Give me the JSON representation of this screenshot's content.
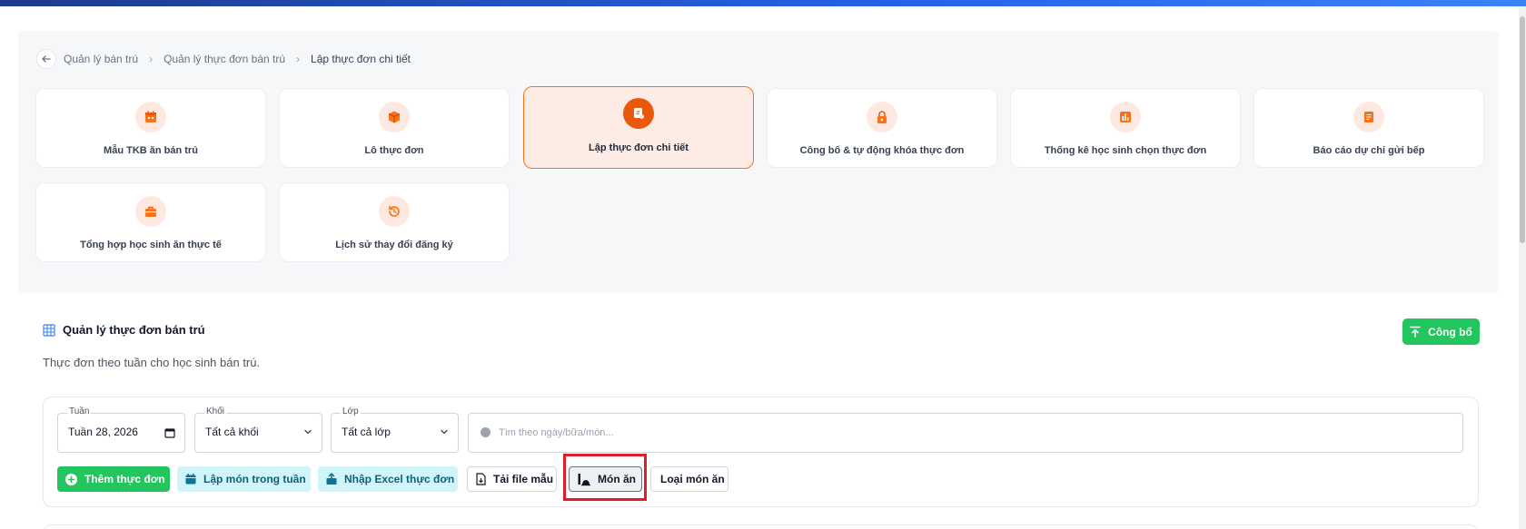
{
  "breadcrumb": {
    "items": [
      "Quản lý bán trú",
      "Quản lý thực đơn bán trú"
    ],
    "current": "Lập thực đơn chi tiết"
  },
  "tiles": [
    {
      "label": "Mẫu TKB ăn bán trú",
      "icon": "calendar-icon",
      "active": false
    },
    {
      "label": "Lô thực đơn",
      "icon": "box-icon",
      "active": false
    },
    {
      "label": "Lập thực đơn chi tiết",
      "icon": "recipe-icon",
      "active": true
    },
    {
      "label": "Công bố & tự động khóa thực đơn",
      "icon": "lock-icon",
      "active": false
    },
    {
      "label": "Thống kê học sinh chọn thực đơn",
      "icon": "bar-chart-icon",
      "active": false
    },
    {
      "label": "Báo cáo dự chi gửi bếp",
      "icon": "report-icon",
      "active": false
    },
    {
      "label": "Tổng hợp học sinh ăn thực tế",
      "icon": "briefcase-icon",
      "active": false
    },
    {
      "label": "Lịch sử thay đổi đăng ký",
      "icon": "history-icon",
      "active": false
    }
  ],
  "section": {
    "title": "Quản lý thực đơn bán trú",
    "subtitle": "Thực đơn theo tuần cho học sinh bán trú.",
    "publish_label": "Công bố"
  },
  "filters": {
    "week": {
      "label": "Tuần",
      "value": "Tuần 28, 2026"
    },
    "grade": {
      "label": "Khối",
      "value": "Tất cả khối"
    },
    "class": {
      "label": "Lớp",
      "value": "Tất cả lớp"
    },
    "search_placeholder": "Tìm theo ngày/bữa/món..."
  },
  "actions": {
    "add_menu": "Thêm thực đơn",
    "weekly_dishes": "Lập món trong tuần",
    "import_excel": "Nhập Excel thực đơn",
    "download_template": "Tải file mẫu",
    "dishes": "Món ăn",
    "dish_types": "Loại món ăn"
  },
  "colors": {
    "accent_orange": "#ea580c",
    "green": "#22c55e",
    "cyan_bg": "#cff5fb",
    "highlight_red": "#e11d2a"
  }
}
